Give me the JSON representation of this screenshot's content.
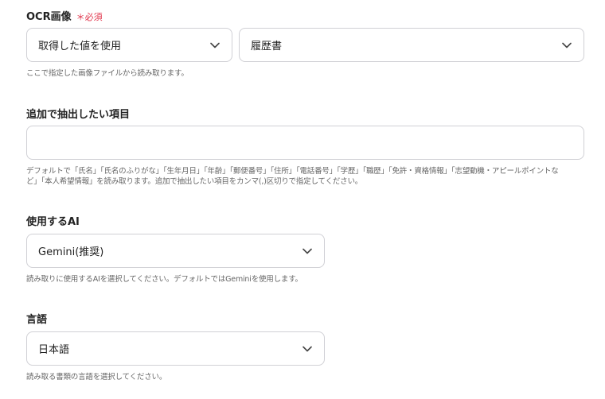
{
  "ocr": {
    "label": "OCR画像",
    "required_mark": "＊必須",
    "source_select": "取得した値を使用",
    "type_select": "履歴書",
    "help": "ここで指定した画像ファイルから読み取ります。"
  },
  "extra": {
    "label": "追加で抽出したい項目",
    "value": "",
    "help_line1": "デフォルトで「氏名」「氏名のふりがな」「生年月日」「年齢」「郵便番号」「住所」「電話番号」「学歴」「職歴」「免許・資格情報」「志望動機・アピールポイントな",
    "help_line2": "ど」「本人希望情報」を読み取ります。追加で抽出したい項目をカンマ(,)区切りで指定してください。"
  },
  "ai": {
    "label": "使用するAI",
    "select": "Gemini(推奨)",
    "help": "読み取りに使用するAIを選択してください。デフォルトではGeminiを使用します。"
  },
  "language": {
    "label": "言語",
    "select": "日本語",
    "help": "読み取る書類の言語を選択してください。"
  },
  "icons": {
    "dropdown": "chevron-down-icon"
  }
}
